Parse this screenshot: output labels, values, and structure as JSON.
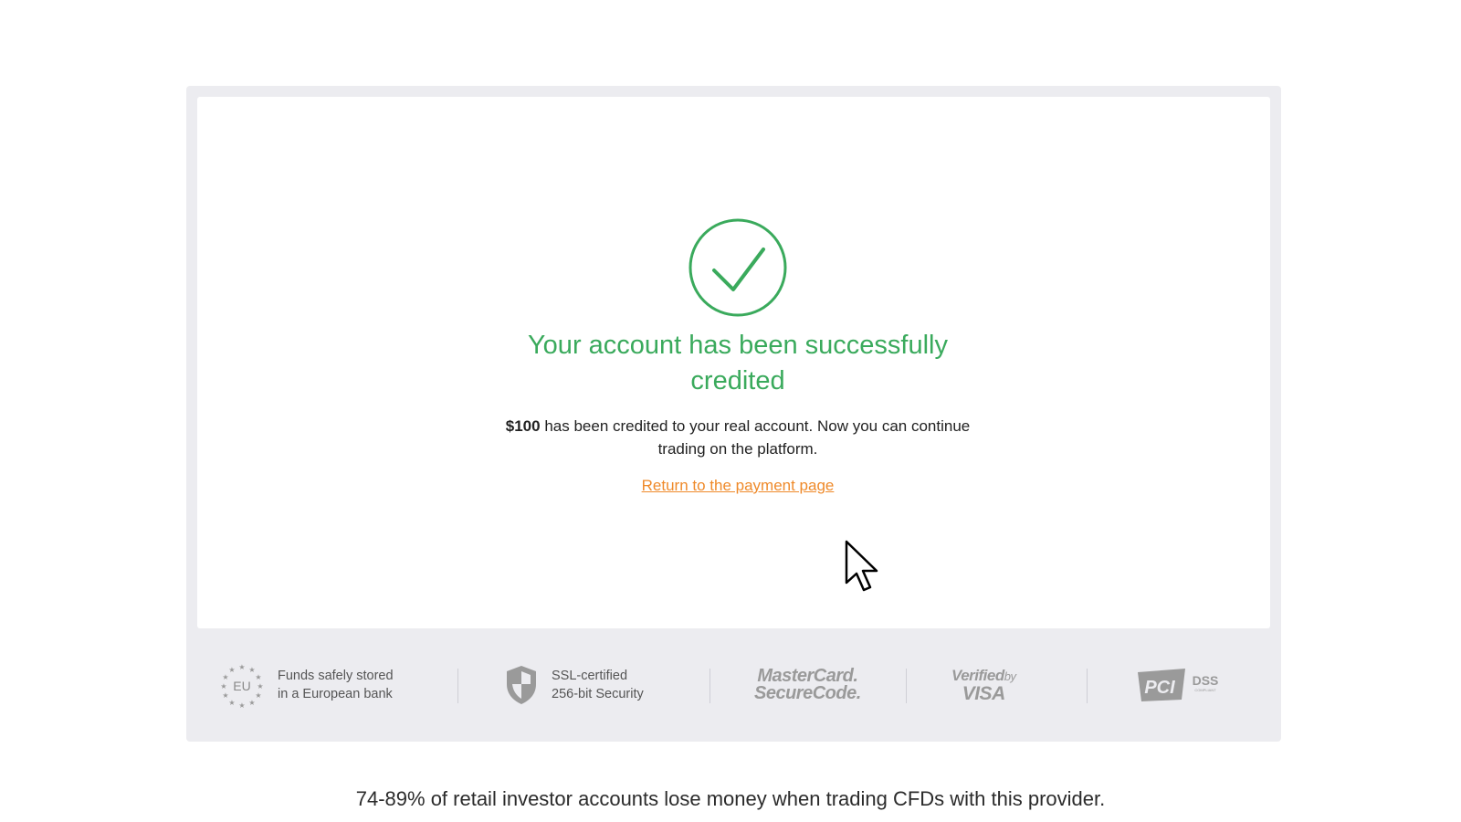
{
  "confirmation": {
    "title": "Your account has been successfully credited",
    "amount": "$100",
    "message": "has been credited to your real account. Now you can continue trading on the platform.",
    "return_link": "Return to the payment page",
    "icon": "check-circle-icon",
    "accent_color": "#3aaa5c",
    "link_color": "#ef8a2a"
  },
  "trust_badges": {
    "eu": {
      "icon_label": "EU",
      "line1": "Funds safely stored",
      "line2": "in a European bank"
    },
    "ssl": {
      "line1": "SSL-certified",
      "line2": "256-bit Security"
    },
    "mastercard": {
      "line1": "MasterCard.",
      "line2": "SecureCode."
    },
    "visa": {
      "line1": "Verified",
      "by": "by",
      "line2": "VISA"
    },
    "pci": {
      "logo": "PCI",
      "text": "DSS",
      "sub": "COMPLIANT"
    }
  },
  "disclaimer": "74-89% of retail investor accounts lose money when trading CFDs with this provider."
}
